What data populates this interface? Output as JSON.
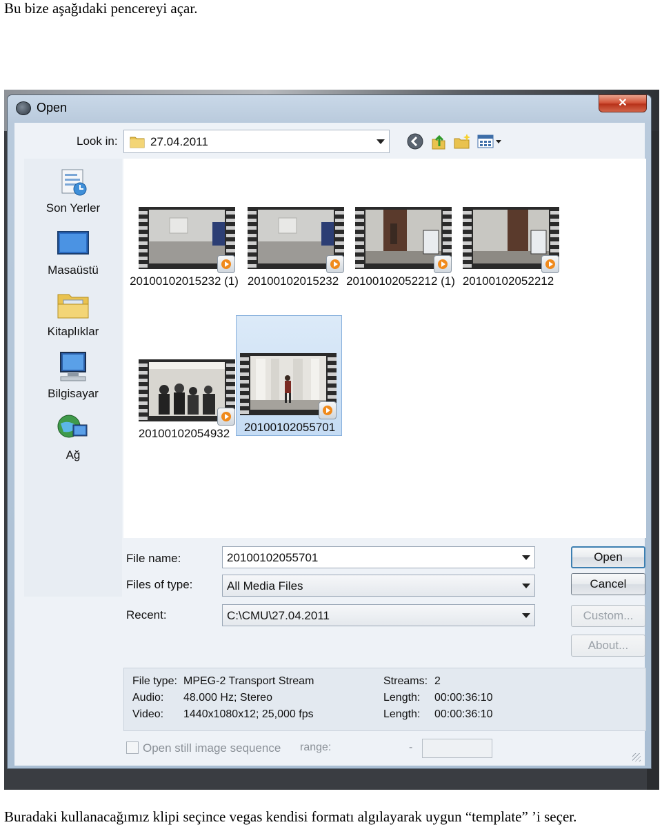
{
  "doc": {
    "caption_top": "Bu bize aşağıdaki pencereyi açar.",
    "caption_bottom": "Buradaki kullanacağımız klipi seçince vegas kendisi formatı algılayarak uygun “template” ’i seçer."
  },
  "window": {
    "title": "Open",
    "close_glyph": "✕"
  },
  "lookin": {
    "label": "Look in:",
    "value": "27.04.2011"
  },
  "places": [
    {
      "label": "Son Yerler",
      "icon": "recent-places-icon"
    },
    {
      "label": "Masaüstü",
      "icon": "desktop-icon"
    },
    {
      "label": "Kitaplıklar",
      "icon": "libraries-icon"
    },
    {
      "label": "Bilgisayar",
      "icon": "computer-icon"
    },
    {
      "label": "Ağ",
      "icon": "network-icon"
    }
  ],
  "files": [
    {
      "name": "20100102015232 (1)",
      "selected": false,
      "scene": "room"
    },
    {
      "name": "20100102015232",
      "selected": false,
      "scene": "room"
    },
    {
      "name": "20100102052212 (1)",
      "selected": false,
      "scene": "door"
    },
    {
      "name": "20100102052212",
      "selected": false,
      "scene": "door"
    },
    {
      "name": "20100102054932",
      "selected": false,
      "scene": "people"
    },
    {
      "name": "20100102055701",
      "selected": true,
      "scene": "stage"
    }
  ],
  "form": {
    "filename_label": "File name:",
    "filename_value": "20100102055701",
    "filetype_label": "Files of type:",
    "filetype_value": "All Media Files",
    "recent_label": "Recent:",
    "recent_value": "C:\\CMU\\27.04.2011"
  },
  "buttons": {
    "open": "Open",
    "cancel": "Cancel",
    "custom": "Custom...",
    "about": "About..."
  },
  "info": {
    "filetype_label": "File type:",
    "filetype_value": "MPEG-2 Transport Stream",
    "audio_label": "Audio:",
    "audio_value": "48.000 Hz; Stereo",
    "video_label": "Video:",
    "video_value": "1440x1080x12; 25,000 fps",
    "streams_label": "Streams:",
    "streams_value": "2",
    "length1_label": "Length:",
    "length1_value": "00:00:36:10",
    "length2_label": "Length:",
    "length2_value": "00:00:36:10"
  },
  "bottom": {
    "still_label": "Open still image sequence",
    "range_label": "range:",
    "range_dash": "-"
  }
}
